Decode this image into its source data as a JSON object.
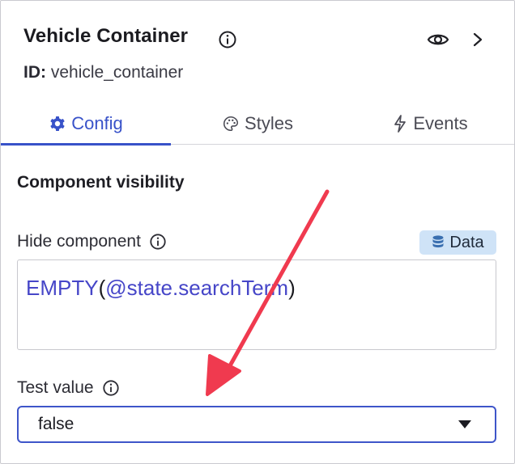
{
  "header": {
    "title": "Vehicle Container",
    "id_label": "ID:",
    "id_value": "vehicle_container",
    "icons": {
      "info": "info-icon",
      "eye": "eye-icon",
      "chevron": "chevron-right-icon"
    }
  },
  "tabs": [
    {
      "label": "Config",
      "icon": "gear-icon",
      "active": true
    },
    {
      "label": "Styles",
      "icon": "palette-icon",
      "active": false
    },
    {
      "label": "Events",
      "icon": "lightning-icon",
      "active": false
    }
  ],
  "config": {
    "section_title": "Component visibility",
    "hide_component": {
      "label": "Hide component",
      "badge_label": "Data",
      "badge_icon": "database-icon",
      "expression": {
        "function": "EMPTY",
        "open_paren": "(",
        "reference": "@state.searchTerm",
        "close_paren": ")"
      }
    },
    "test_value": {
      "label": "Test value",
      "selected": "false"
    }
  },
  "colors": {
    "accent": "#3852c9",
    "expression_blue": "#4646c8",
    "badge_bg": "#cfe3f7",
    "annotation_arrow": "#f03a4f"
  }
}
